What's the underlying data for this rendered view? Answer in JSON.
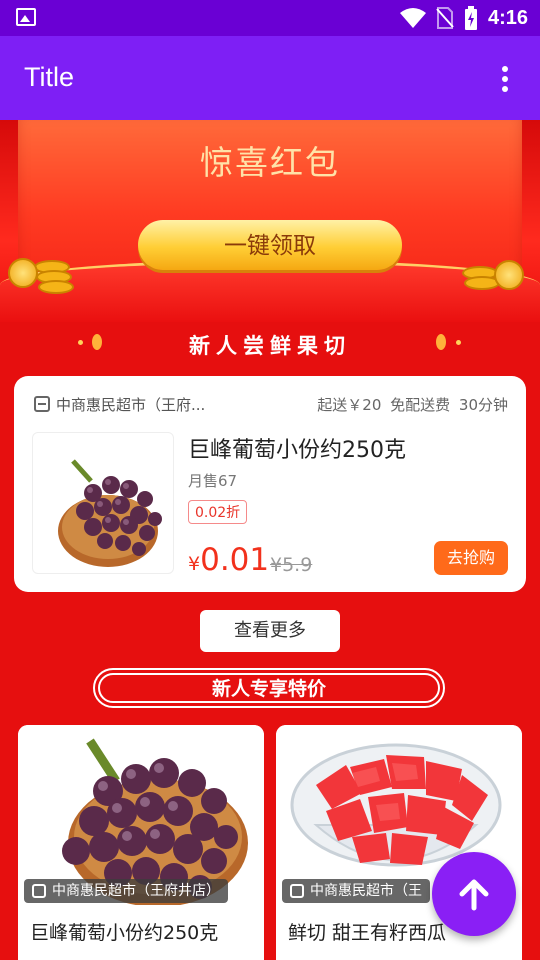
{
  "status_bar": {
    "time": "4:16"
  },
  "app_bar": {
    "title": "Title"
  },
  "banner": {
    "heading": "惊喜红包",
    "button_label": "一键领取"
  },
  "section_fruit": {
    "heading": "新人尝鲜果切"
  },
  "product_card": {
    "store_name": "中商惠民超市（王府...",
    "meta": "起送￥20  免配送费  30分钟",
    "name": "巨峰葡萄小份约250克",
    "sales": "月售67",
    "discount": "0.02折",
    "currency": "¥",
    "price": "0.01",
    "original_price": "¥5.9",
    "buy_label": "去抢购"
  },
  "more_label": "查看更多",
  "section_exclusive": {
    "heading": "新人专享特价"
  },
  "grid_items": [
    {
      "store": "中商惠民超市（王府井店）",
      "name": "巨峰葡萄小份约250克"
    },
    {
      "store": "中商惠民超市（王",
      "name": "鲜切 甜王有籽西瓜"
    }
  ],
  "colors": {
    "app_bar": "#7e1ff5",
    "status_bar": "#6a00d4",
    "background": "#e60f0f",
    "price": "#f2311c",
    "fab": "#8a1ff5"
  },
  "icons": [
    "image-icon",
    "wifi-icon",
    "no-sim-icon",
    "battery-icon",
    "more-vert-icon",
    "store-icon",
    "arrow-up-icon"
  ]
}
